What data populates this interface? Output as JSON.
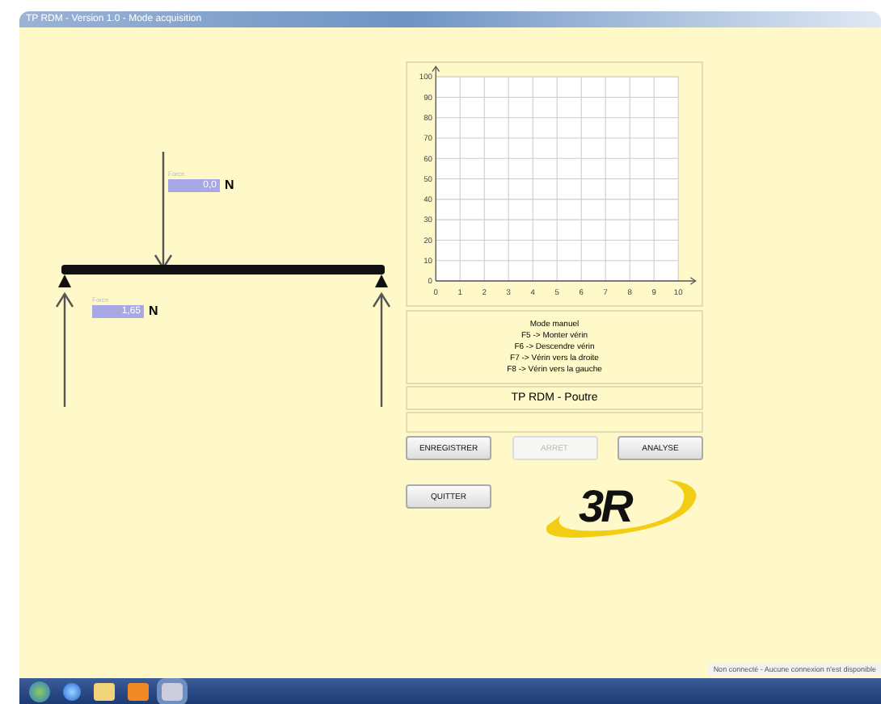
{
  "window": {
    "title": "TP RDM - Version 1.0 - Mode acquisition"
  },
  "load": {
    "caption": "Force",
    "value": "0,0",
    "unit": "N"
  },
  "reaction": {
    "caption": "Force",
    "value": "1,65",
    "unit": "N"
  },
  "chart_data": {
    "type": "line",
    "grid": true,
    "xlim": [
      0,
      10
    ],
    "ylim": [
      0,
      100
    ],
    "xticks": [
      0,
      1,
      2,
      3,
      4,
      5,
      6,
      7,
      8,
      9,
      10
    ],
    "yticks": [
      0,
      10,
      20,
      30,
      40,
      50,
      60,
      70,
      80,
      90,
      100
    ]
  },
  "legend": [
    "Mode manuel",
    "F5 -> Monter vérin",
    "F6 -> Descendre vérin",
    "F7 -> Vérin vers la droite",
    "F8 -> Vérin vers la gauche"
  ],
  "banner": "TP RDM - Poutre",
  "buttons": [
    {
      "label": "ENREGISTRER",
      "disabled": false
    },
    {
      "label": "ARRET",
      "disabled": true
    },
    {
      "label": "ANALYSE",
      "disabled": false
    }
  ],
  "quit": "QUITTER",
  "logo": "3R",
  "status": "Non connecté - Aucune connexion n'est disponible"
}
